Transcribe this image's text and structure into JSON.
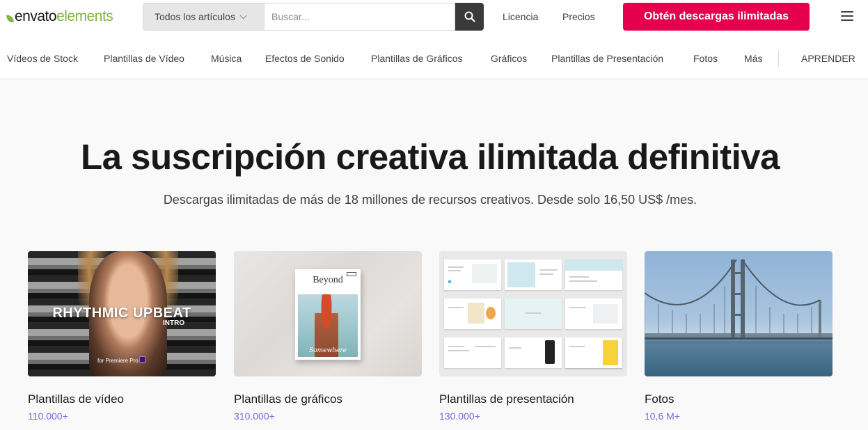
{
  "header": {
    "logo_brand": "envato",
    "logo_sub": "elements",
    "search_category": "Todos los artículos",
    "search_placeholder": "Buscar...",
    "links": [
      "Licencia",
      "Precios"
    ],
    "cta_label": "Obtén descargas ilimitadas"
  },
  "nav": {
    "items": [
      "Vídeos de Stock",
      "Plantillas de Vídeo",
      "Música",
      "Efectos de Sonido",
      "Plantillas de Gráficos",
      "Gráficos",
      "Plantillas de Presentación",
      "Fotos",
      "Más"
    ],
    "learn_label": "APRENDER"
  },
  "hero": {
    "title": "La suscripción creativa ilimitada definitiva",
    "subtitle": "Descargas ilimitadas de más de 18 millones de recursos creativos. Desde solo 16,50 US$ /mes."
  },
  "cards": [
    {
      "name": "Plantillas de vídeo",
      "count": "110.000+",
      "thumb_text": "RHYTHMIC UPBEAT",
      "thumb_sub": "INTRO",
      "thumb_caption": "for Premiere Pro"
    },
    {
      "name": "Plantillas de gráficos",
      "count": "310.000+",
      "thumb_text": "Beyond",
      "thumb_sub": "Somewhere"
    },
    {
      "name": "Plantillas de presentación",
      "count": "130.000+"
    },
    {
      "name": "Fotos",
      "count": "10,6 M+"
    }
  ],
  "colors": {
    "cta": "#e4004d",
    "brand_green": "#82b541",
    "count": "#7b6bd8"
  },
  "icons": {
    "search": "search-icon",
    "menu": "hamburger-menu-icon",
    "dropdown": "chevron-down-icon"
  }
}
